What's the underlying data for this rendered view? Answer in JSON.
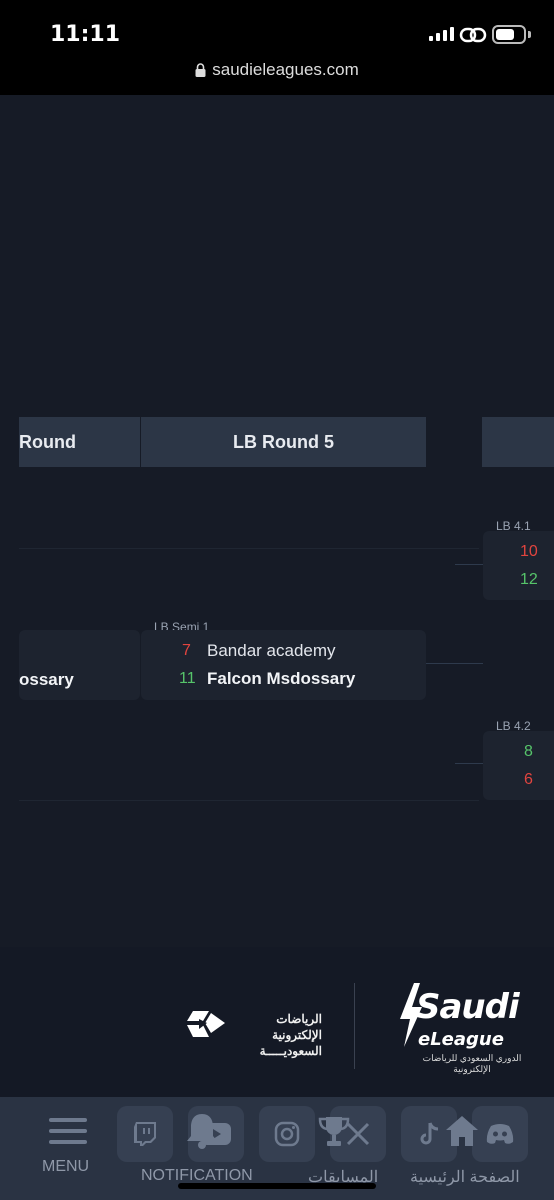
{
  "status_bar": {
    "time": "11:11",
    "url": "saudieleagues.com"
  },
  "bracket": {
    "headers": {
      "left_partial": "Round",
      "main": "LB Round 5"
    },
    "left_match": {
      "team_partial": "ossary"
    },
    "semi": {
      "label": "LB Semi 1",
      "rows": [
        {
          "score": "7",
          "team": "Bandar academy"
        },
        {
          "score": "11",
          "team": "Falcon Msdossary"
        }
      ]
    },
    "lb41": {
      "label": "LB 4.1",
      "scores": [
        "10",
        "12"
      ]
    },
    "lb42": {
      "label": "LB 4.2",
      "scores": [
        "8",
        "6"
      ]
    }
  },
  "footer": {
    "sa_text_line1": "الرياضات الإلكترونية",
    "sa_text_line2": "السعوديـــــة",
    "sel_title": "Saudi",
    "sel_sub": "eLeague",
    "sel_arabic": "الدوري السعودي للرياضات الإلكترونية"
  },
  "bottom_nav": {
    "menu_label": "MENU",
    "notification_label": "NOTIFICATION",
    "competitions_label": "المسابقات",
    "home_label": "الصفحة الرئيسية"
  },
  "colors": {
    "loss": "#e1443f",
    "win": "#56c46a",
    "background": "#161b26"
  }
}
